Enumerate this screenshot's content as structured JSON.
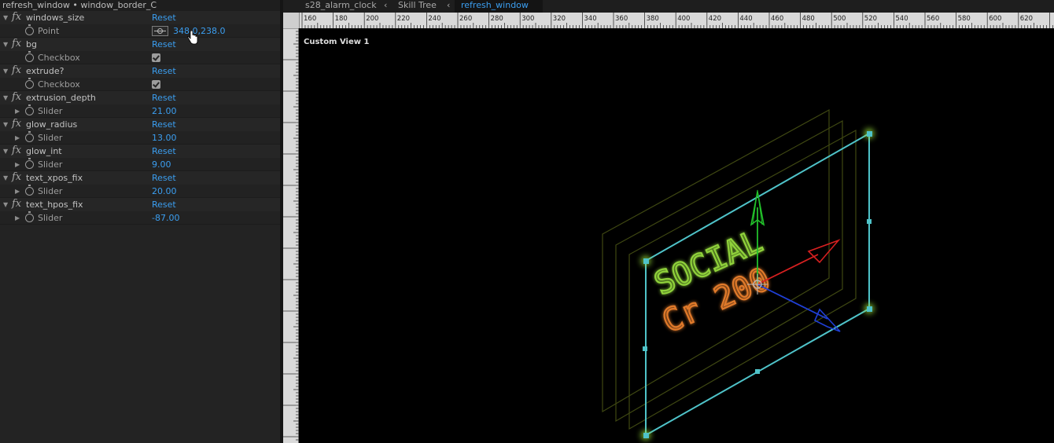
{
  "effects_panel": {
    "title": "refresh_window • window_border_C",
    "reset_label": "Reset",
    "items": [
      {
        "name": "windows_size",
        "param_type": "Point",
        "value": "348.0,238.0"
      },
      {
        "name": "bg",
        "param_type": "Checkbox",
        "checked": true
      },
      {
        "name": "extrude?",
        "param_type": "Checkbox",
        "checked": true
      },
      {
        "name": "extrusion_depth",
        "param_type": "Slider",
        "value": "21.00"
      },
      {
        "name": "glow_radius",
        "param_type": "Slider",
        "value": "13.00"
      },
      {
        "name": "glow_int",
        "param_type": "Slider",
        "value": "9.00"
      },
      {
        "name": "text_xpos_fix",
        "param_type": "Slider",
        "value": "20.00"
      },
      {
        "name": "text_hpos_fix",
        "param_type": "Slider",
        "value": "-87.00"
      }
    ]
  },
  "viewer": {
    "tabs": [
      {
        "label": "s28_alarm_clock",
        "active": false
      },
      {
        "label": "Skill Tree",
        "active": false
      },
      {
        "label": "refresh_window",
        "active": true
      }
    ],
    "view_name": "Custom View 1",
    "ruler_labels": [
      "160",
      "180",
      "200",
      "220",
      "240",
      "260",
      "280",
      "300",
      "320",
      "340",
      "360",
      "380",
      "400",
      "420",
      "440",
      "460",
      "480",
      "500",
      "520",
      "540",
      "560",
      "580",
      "600",
      "620"
    ],
    "scene_text_line1": "SOCIAL",
    "scene_text_line2": "Cr 200",
    "colors": {
      "accent": "#3b9ef0",
      "layer_outline": "#4fc3c9",
      "text_green": "#8fd13a",
      "text_orange": "#e07a2c",
      "axis_x": "#d62020",
      "axis_y": "#22c02a",
      "axis_z": "#1f3fd6"
    }
  }
}
